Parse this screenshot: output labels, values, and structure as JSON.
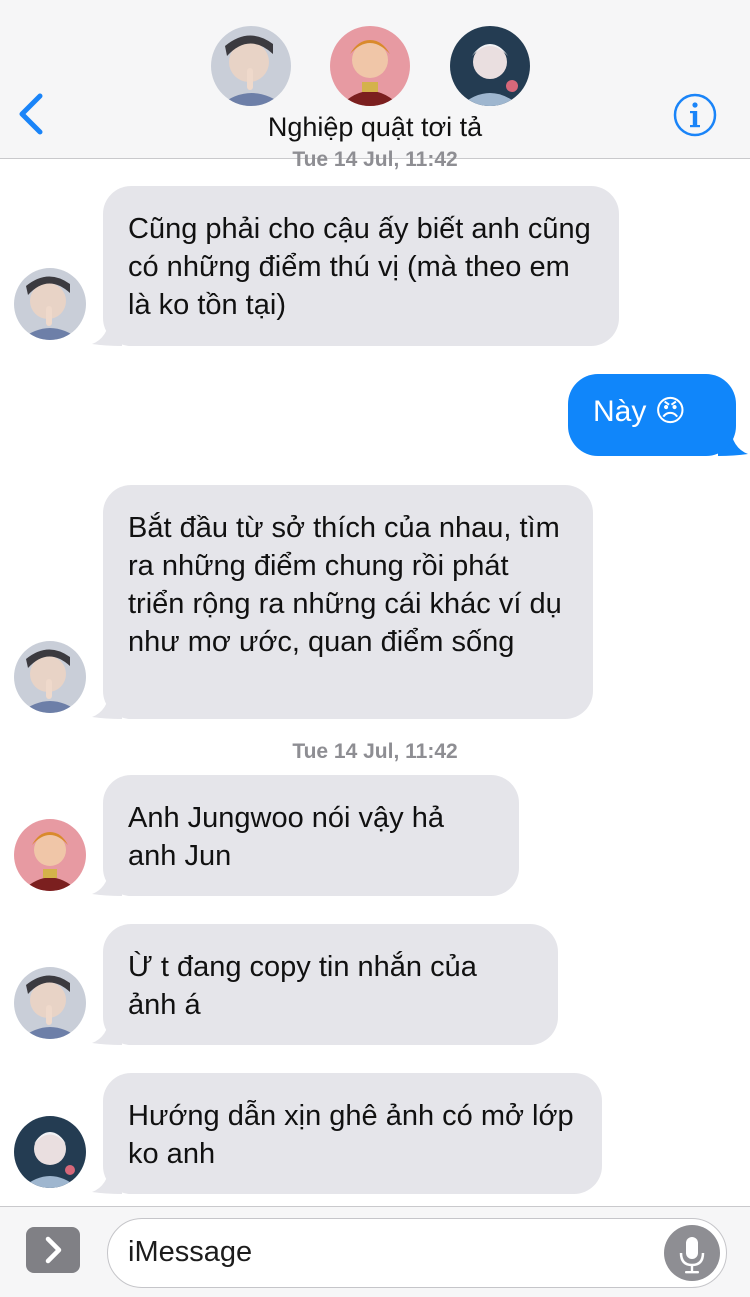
{
  "header": {
    "title": "Nghiệp quật tơi tả",
    "back_icon": "chevron-left-icon",
    "info_icon": "info-icon",
    "accent_color": "#1a84f8",
    "participants": [
      "avatar-1",
      "avatar-2",
      "avatar-3"
    ]
  },
  "messages": {
    "top_timestamp": "Tue 14 Jul, 11:42",
    "m1": "Cũng phải cho cậu ấy biết anh cũng có những điểm thú vị (mà theo em là ko tồn tại)",
    "m2": "Này 😠",
    "m3": "Bắt đầu từ sở thích của nhau, tìm ra những điểm chung rồi phát triển rộng ra những cái khác ví dụ như mơ ước, quan điểm sống",
    "timestamp2": "Tue 14 Jul, 11:42",
    "m4": "Anh Jungwoo nói vậy hả anh Jun",
    "m5": "Ừ t đang copy tin nhắn của ảnh á",
    "m6": "Hướng dẫn xịn ghê ảnh có mở lớp ko anh"
  },
  "input": {
    "placeholder": "iMessage",
    "apps_icon": "chevron-right-icon",
    "mic_icon": "microphone-icon"
  },
  "colors": {
    "sent_bubble": "#1086fa",
    "received_bubble": "#e5e5ea",
    "timestamp": "#8e8e93"
  }
}
